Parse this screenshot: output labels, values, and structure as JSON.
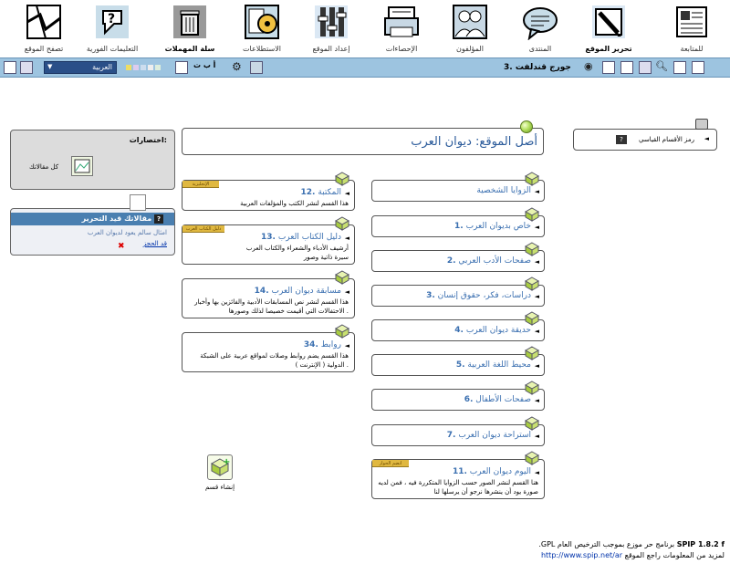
{
  "nav": {
    "items": [
      {
        "key": "followup",
        "label": "للمتابعة",
        "icon": "newspaper-icon"
      },
      {
        "key": "edit_site",
        "label": "تحرير الموقع",
        "icon": "pen-icon",
        "active": true
      },
      {
        "key": "forum",
        "label": "المنتدى",
        "icon": "speech-bubble-icon"
      },
      {
        "key": "authors",
        "label": "المؤلفون",
        "icon": "people-icon"
      },
      {
        "key": "stats",
        "label": "الإحصاءات",
        "icon": "printer-icon"
      },
      {
        "key": "setup",
        "label": "إعداد الموقع",
        "icon": "tools-icon"
      },
      {
        "key": "options",
        "label": "الاستطلاعات",
        "icon": "gear-document-icon"
      },
      {
        "key": "trash",
        "label": "سلة المهملات",
        "icon": "trash-icon",
        "active": true
      },
      {
        "key": "help",
        "label": "التعليمات الفورية",
        "icon": "help-icon"
      },
      {
        "key": "visit",
        "label": "تصفح الموقع",
        "icon": "map-icon"
      }
    ]
  },
  "toolbar": {
    "site_name": "3. جورج قندلفت",
    "lang_value": "العربية",
    "aa_label": "أ ب ت"
  },
  "shortcuts": {
    "title": "اختصارات:",
    "item_label": "كل مقالاتك"
  },
  "edit_panel": {
    "title": "مقالاتك قيد التحرير",
    "help": "?",
    "item": "امثال سالم يعود لديوان العرب",
    "delete": "قد الحجز"
  },
  "site_title": "أصل الموقع: ديوان العرب",
  "sector": {
    "label": "رمز الأقسام القياسي",
    "help": "?"
  },
  "rubrics_right": [
    {
      "num": "",
      "name": "الزوايا الشخصية"
    },
    {
      "num": "1.",
      "name": "خاص بديوان العرب"
    },
    {
      "num": "2.",
      "name": "صفحات الأدب العربي"
    },
    {
      "num": "3.",
      "name": "دراسات، فكر، حقوق إنسان"
    },
    {
      "num": "4.",
      "name": "حديقة ديوان العرب"
    },
    {
      "num": "5.",
      "name": "محيط اللغة العربية"
    },
    {
      "num": "6.",
      "name": "صفحات الأطفال"
    },
    {
      "num": "7.",
      "name": "استراحة ديوان العرب"
    },
    {
      "num": "11.",
      "name": "اليوم ديوان العرب",
      "badge": "انضم الحوار",
      "desc": "هنا القسم لنشر الصور حسب الزوايا المتكررة فيه ، فمن لديه صورة يود أن ينشرها نرجو أن يرسلها لنا"
    }
  ],
  "rubrics_left": [
    {
      "num": "12.",
      "name": "المكتبة",
      "badge": "الإنجليزية",
      "desc": "هذا القسم لنشر الكتب والمؤلفات العربية"
    },
    {
      "num": "13.",
      "name": "دليل الكتاب العرب",
      "badge": "دليل الكتاب العرب",
      "desc": "أرشيف الأدباء والشعراء والكتاب العرب سيرة ذاتية وصور"
    },
    {
      "num": "14.",
      "name": "مسابقة ديوان العرب",
      "desc": "هذا القسم لنشر نص المسابقات الأدبية والفائزين بها وأخبار الاحتفالات التي أقيمت خصيصا لذلك وصورها ."
    },
    {
      "num": "34.",
      "name": "روابط",
      "desc": "هذا القسم يضم روابط وصلات لمواقع عربية على الشبكة الدولية ( الإنترنت ) ."
    }
  ],
  "create": {
    "label": "إنشاء قسم"
  },
  "footer": {
    "version": "SPIP 1.8.2 f",
    "license": "برنامج حر موزع بموجب الترخيص العام GPL.",
    "more": "لمزيد من المعلومات راجع الموقع",
    "url": "http://www.spip.net/ar"
  },
  "colors": {
    "toolbar": "#9dc4e0",
    "link": "#3a6fb0",
    "header_blue": "#4a7fb0",
    "badge": "#e0b840"
  }
}
